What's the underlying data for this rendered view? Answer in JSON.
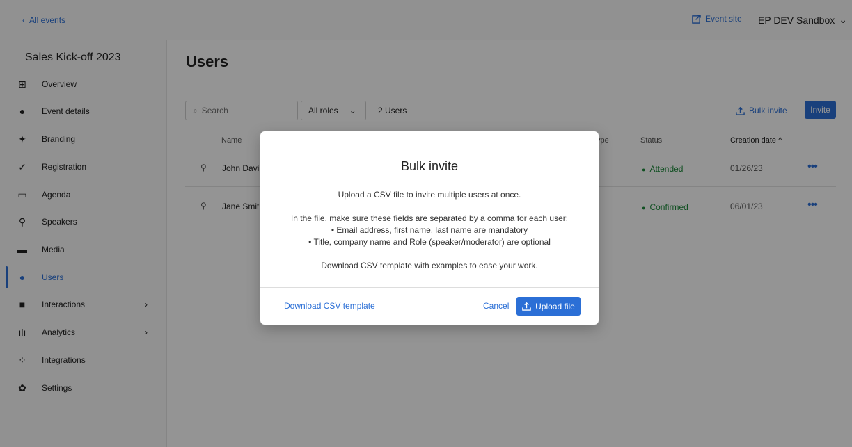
{
  "topbar": {
    "back_label": "All events",
    "event_site_label": "Event site",
    "workspace_label": "EP DEV Sandbox"
  },
  "sidebar": {
    "event_title": "Sales Kick-off 2023",
    "items": [
      {
        "label": "Overview",
        "icon": "grid-icon"
      },
      {
        "label": "Event details",
        "icon": "info-icon"
      },
      {
        "label": "Branding",
        "icon": "sparkle-icon"
      },
      {
        "label": "Registration",
        "icon": "check-icon"
      },
      {
        "label": "Agenda",
        "icon": "calendar-icon"
      },
      {
        "label": "Speakers",
        "icon": "speaker-icon"
      },
      {
        "label": "Media",
        "icon": "folder-icon"
      },
      {
        "label": "Users",
        "icon": "user-icon",
        "active": true
      },
      {
        "label": "Interactions",
        "icon": "chat-icon",
        "expandable": true
      },
      {
        "label": "Analytics",
        "icon": "bar-chart-icon",
        "expandable": true
      },
      {
        "label": "Integrations",
        "icon": "integrations-icon"
      },
      {
        "label": "Settings",
        "icon": "gear-icon"
      }
    ]
  },
  "main": {
    "title": "Users",
    "search_placeholder": "Search",
    "roles_filter": "All roles",
    "user_count": "2 Users",
    "bulk_invite_label": "Bulk invite",
    "invite_label": "Invite",
    "columns": {
      "name": "Name",
      "type": "ype",
      "status": "Status",
      "created": "Creation date ^"
    },
    "rows": [
      {
        "name": "John Davis",
        "status": "Attended",
        "date": "01/26/23"
      },
      {
        "name": "Jane Smith",
        "status": "Confirmed",
        "date": "06/01/23"
      }
    ]
  },
  "modal": {
    "title": "Bulk invite",
    "line1": "Upload a CSV file to invite multiple users at once.",
    "line2": "In the file, make sure these fields are separated by a comma for each user:",
    "line3": "• Email address, first name, last name are mandatory",
    "line4": "• Title, company name and Role (speaker/moderator) are optional",
    "line5": "Download CSV template with examples to ease your work.",
    "download_label": "Download CSV template",
    "cancel_label": "Cancel",
    "upload_label": "Upload file"
  },
  "colors": {
    "accent": "#2b6fd6",
    "success": "#1e8a3c"
  }
}
